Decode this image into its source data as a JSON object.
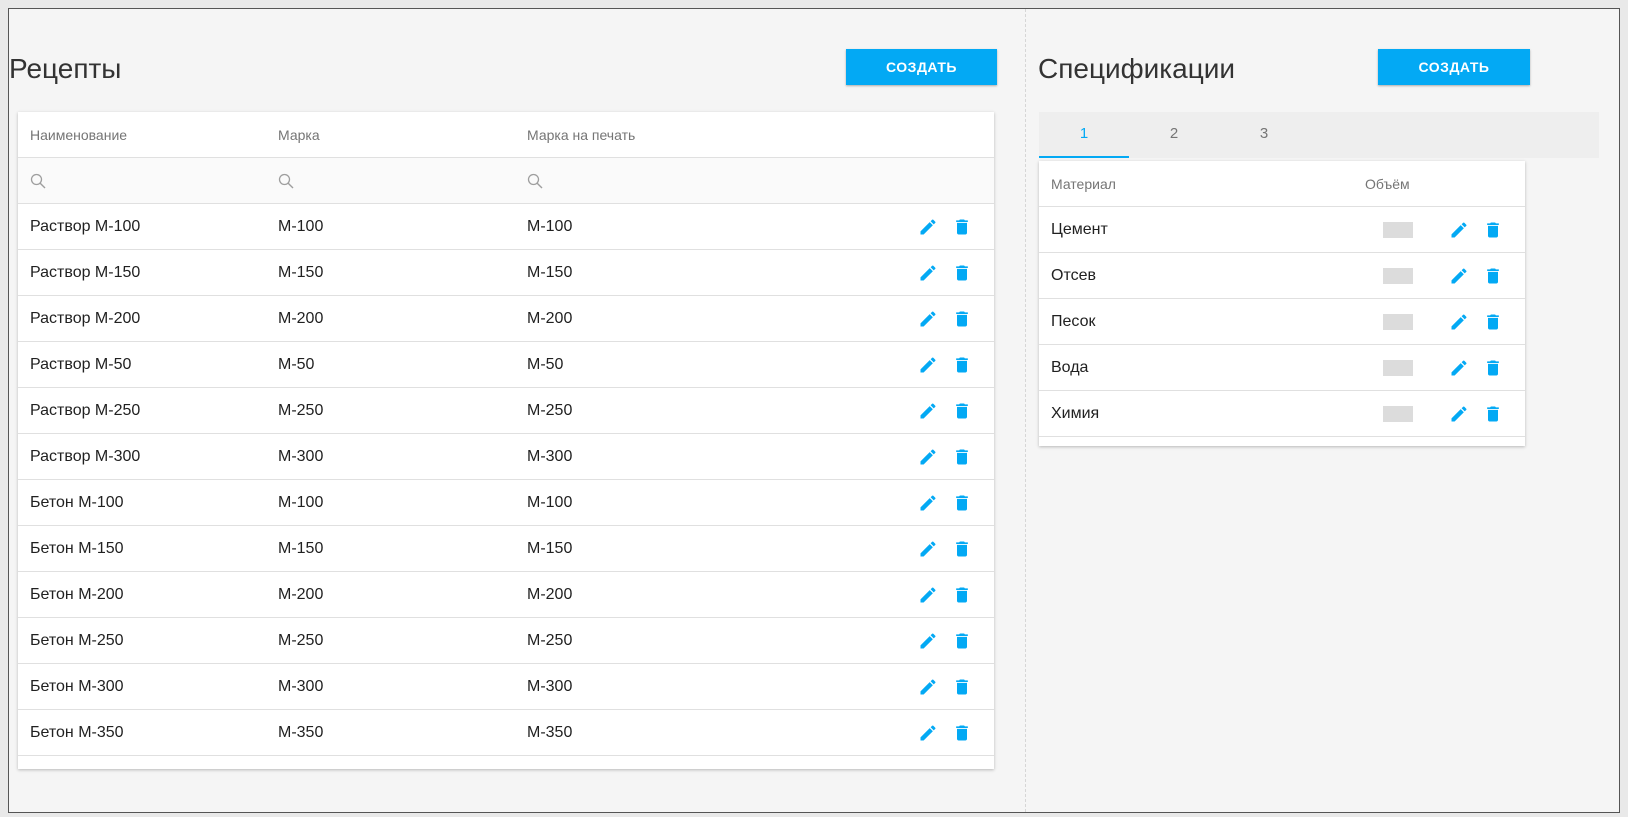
{
  "recipes": {
    "title": "Рецепты",
    "create_label": "СОЗДАТЬ",
    "columns": [
      "Наименование",
      "Марка",
      "Марка на печать"
    ],
    "rows": [
      {
        "name": "Раствор М-100",
        "mark": "М-100",
        "print_mark": "М-100"
      },
      {
        "name": "Раствор М-150",
        "mark": "М-150",
        "print_mark": "М-150"
      },
      {
        "name": "Раствор М-200",
        "mark": "М-200",
        "print_mark": "М-200"
      },
      {
        "name": "Раствор М-50",
        "mark": "М-50",
        "print_mark": "М-50"
      },
      {
        "name": "Раствор М-250",
        "mark": "М-250",
        "print_mark": "М-250"
      },
      {
        "name": "Раствор М-300",
        "mark": "М-300",
        "print_mark": "М-300"
      },
      {
        "name": "Бетон М-100",
        "mark": "М-100",
        "print_mark": "М-100"
      },
      {
        "name": "Бетон М-150",
        "mark": "М-150",
        "print_mark": "М-150"
      },
      {
        "name": "Бетон М-200",
        "mark": "М-200",
        "print_mark": "М-200"
      },
      {
        "name": "Бетон М-250",
        "mark": "М-250",
        "print_mark": "М-250"
      },
      {
        "name": "Бетон М-300",
        "mark": "М-300",
        "print_mark": "М-300"
      },
      {
        "name": "Бетон М-350",
        "mark": "М-350",
        "print_mark": "М-350"
      }
    ]
  },
  "specs": {
    "title": "Спецификации",
    "create_label": "СОЗДАТЬ",
    "tabs": [
      "1",
      "2",
      "3"
    ],
    "active_tab": 0,
    "columns": [
      "Материал",
      "Объём"
    ],
    "rows": [
      {
        "material": "Цемент"
      },
      {
        "material": "Отсев"
      },
      {
        "material": "Песок"
      },
      {
        "material": "Вода"
      },
      {
        "material": "Химия"
      }
    ]
  },
  "icons": {
    "search": "search-icon",
    "edit": "pencil-icon",
    "delete": "trash-icon"
  },
  "colors": {
    "accent": "#03a9f4",
    "background": "#f5f5f5",
    "card": "#ffffff"
  }
}
